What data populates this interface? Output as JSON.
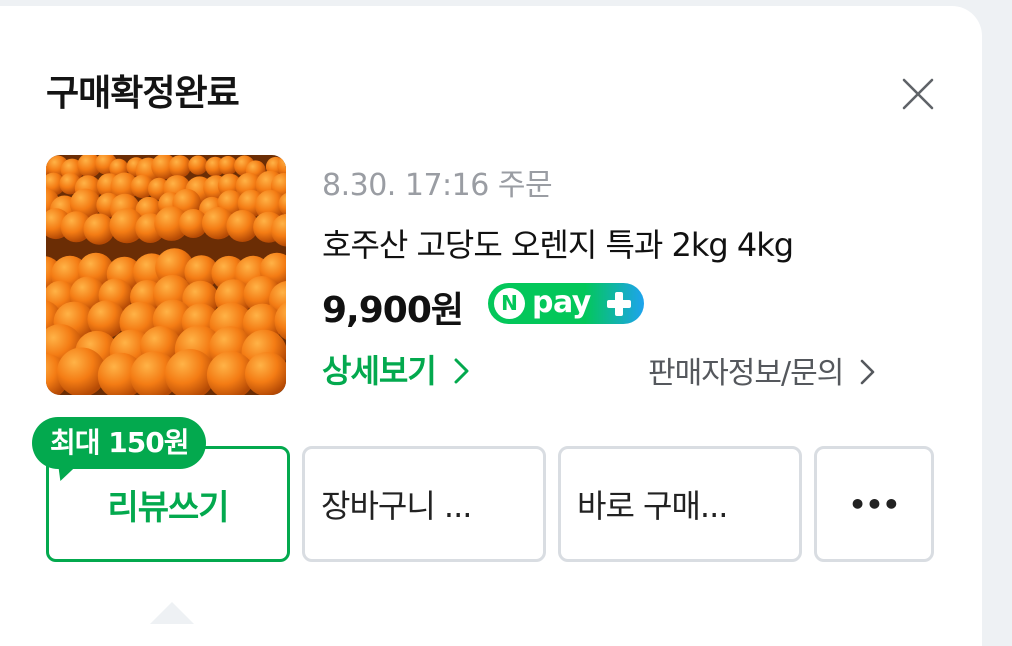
{
  "dialog": {
    "title": "구매확정완료"
  },
  "order": {
    "meta": "8.30. 17:16 주문",
    "product_name": "호주산 고당도 오렌지 특과 2kg 4kg",
    "price": "9,900원",
    "pay_badge": {
      "n_letter": "N",
      "text": "pay"
    },
    "detail_link": "상세보기",
    "seller_link": "판매자정보/문의"
  },
  "actions": {
    "reward_bubble": "최대 150원",
    "review": "리뷰쓰기",
    "cart": "장바구니 ...",
    "buy_now": "바로 구매...",
    "more": "•••"
  },
  "colors": {
    "accent_green": "#03a94e",
    "npay_green": "#03c75a",
    "npay_blue": "#1ea3ee"
  }
}
